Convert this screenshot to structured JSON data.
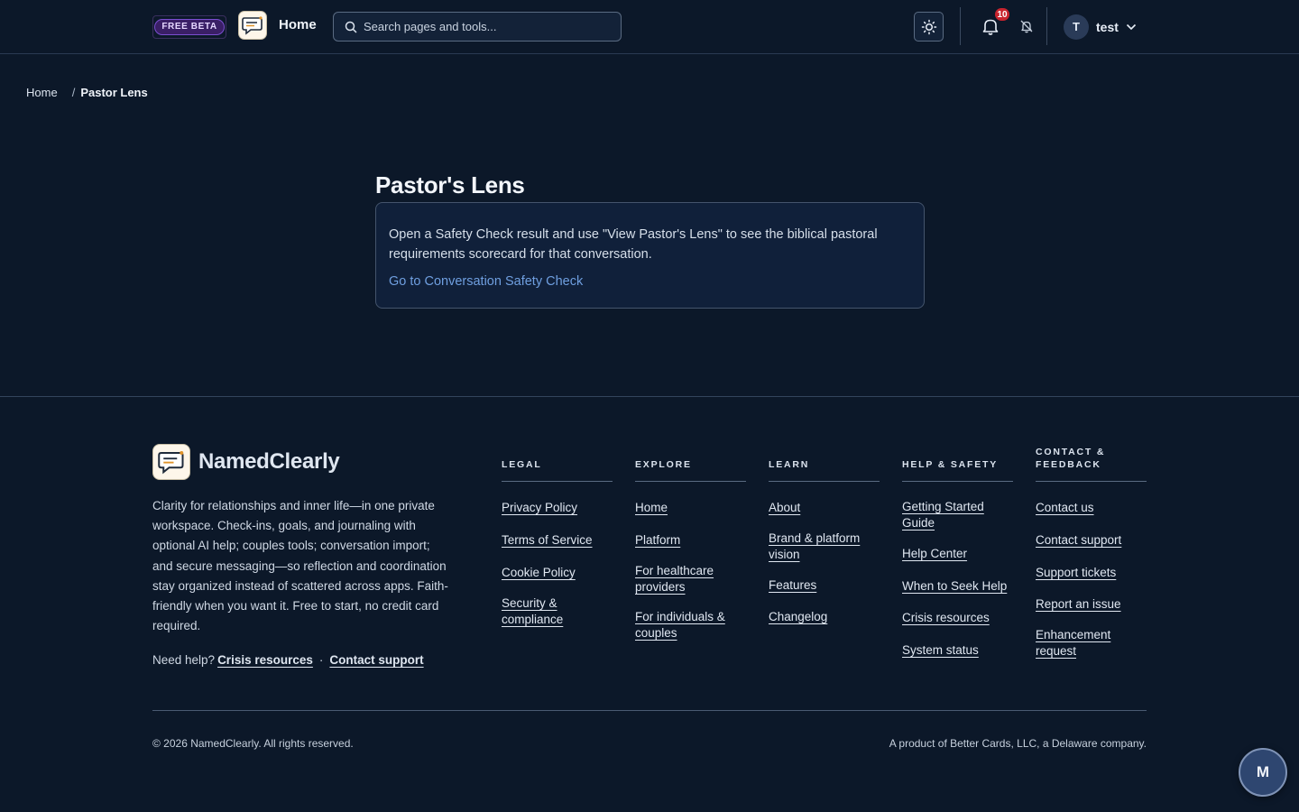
{
  "header": {
    "beta_label": "FREE BETA",
    "home_label": "Home",
    "search_placeholder": "Search pages and tools...",
    "notification_count": "10",
    "user_initial": "T",
    "username": "test"
  },
  "breadcrumb": {
    "home": "Home",
    "separator": "/",
    "current": "Pastor Lens"
  },
  "main": {
    "title": "Pastor's Lens",
    "description": "Open a Safety Check result and use \"View Pastor's Lens\" to see the biblical pastoral requirements scorecard for that conversation.",
    "link_label": "Go to Conversation Safety Check"
  },
  "footer": {
    "brand": "NamedClearly",
    "tagline": "Clarity for relationships and inner life—in one private workspace. Check-ins, goals, and journaling with optional AI help; couples tools; conversation import; and secure messaging—so reflection and coordination stay organized instead of scattered across apps. Faith-friendly when you want it. Free to start, no credit card required.",
    "need_help": "Need help?",
    "crisis_link": "Crisis resources",
    "dot": "·",
    "support_link": "Contact support",
    "columns": [
      {
        "heading": "LEGAL",
        "links": [
          "Privacy Policy",
          "Terms of Service",
          "Cookie Policy",
          "Security & compliance"
        ]
      },
      {
        "heading": "EXPLORE",
        "links": [
          "Home",
          "Platform",
          "For healthcare providers",
          "For individuals & couples"
        ]
      },
      {
        "heading": "LEARN",
        "links": [
          "About",
          "Brand & platform vision",
          "Features",
          "Changelog"
        ]
      },
      {
        "heading": "HELP & SAFETY",
        "links": [
          "Getting Started Guide",
          "Help Center",
          "When to Seek Help",
          "Crisis resources",
          "System status"
        ]
      },
      {
        "heading": "CONTACT & FEEDBACK",
        "links": [
          "Contact us",
          "Contact support",
          "Support tickets",
          "Report an issue",
          "Enhancement request"
        ]
      }
    ],
    "copyright": "© 2026 NamedClearly. All rights reserved.",
    "maker": "A product of Better Cards, LLC, a Delaware company."
  },
  "fab_label": "M",
  "icons": {
    "logo": "chat-bubble-logo-icon",
    "search": "search-icon",
    "theme": "sun-icon",
    "bell": "bell-icon",
    "mute": "bell-off-icon",
    "chevron": "chevron-down-icon"
  },
  "colors": {
    "background": "#0c1829",
    "card": "#10203a",
    "link": "#6f9fe0",
    "badge": "#c8242e",
    "beta": "#3a1f66"
  }
}
